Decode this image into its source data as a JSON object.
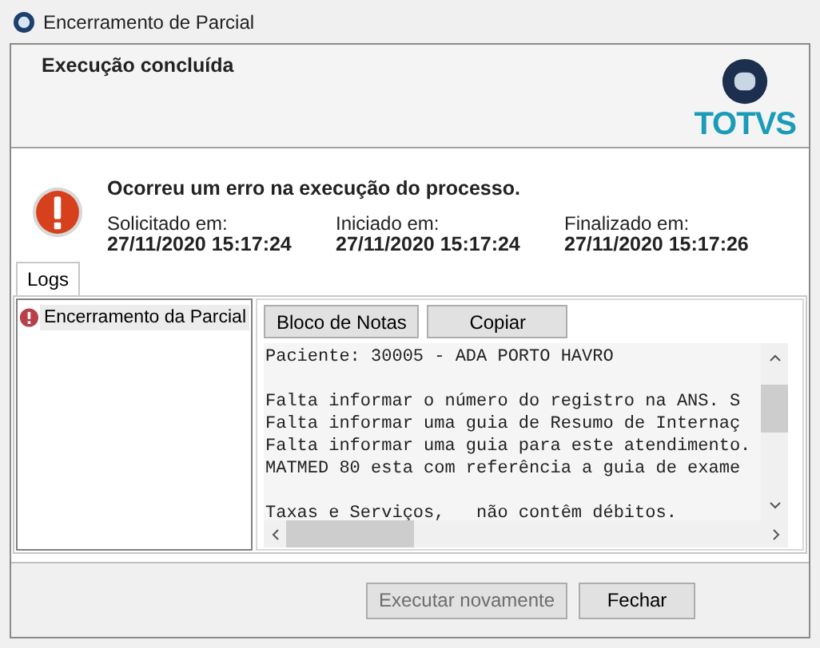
{
  "window": {
    "title": "Encerramento de Parcial"
  },
  "header": {
    "title": "Execução concluída",
    "logo_text": "TOTVS"
  },
  "message": "Ocorreu um erro na execução do processo.",
  "times": [
    {
      "label": "Solicitado em:",
      "value": "27/11/2020 15:17:24"
    },
    {
      "label": "Iniciado em:",
      "value": "27/11/2020 15:17:24"
    },
    {
      "label": "Finalizado em:",
      "value": "27/11/2020 15:17:26"
    }
  ],
  "tabs": [
    {
      "label": "Logs",
      "selected": true
    }
  ],
  "tree": {
    "items": [
      {
        "label": "Encerramento da Parcial",
        "selected": true
      }
    ]
  },
  "log_buttons": [
    "Bloco de Notas",
    "Copiar"
  ],
  "log_lines": [
    {
      "text": "Paciente: 30005 - ADA PORTO HAVRO",
      "gap_before": false
    },
    {
      "text": "Falta informar o número do registro na ANS. S",
      "gap_before": true
    },
    {
      "text": "Falta informar uma guia de Resumo de Internaç",
      "gap_before": false
    },
    {
      "text": "Falta informar uma guia para este atendimento.",
      "gap_before": false
    },
    {
      "text": "MATMED 80 esta com referência a guia de exame",
      "gap_before": false
    },
    {
      "text": "Taxas e Serviços,   não contêm débitos.",
      "gap_before": true
    }
  ],
  "buttons": [
    {
      "label": "Executar novamente",
      "disabled": true
    },
    {
      "label": "Fechar",
      "disabled": false
    }
  ]
}
